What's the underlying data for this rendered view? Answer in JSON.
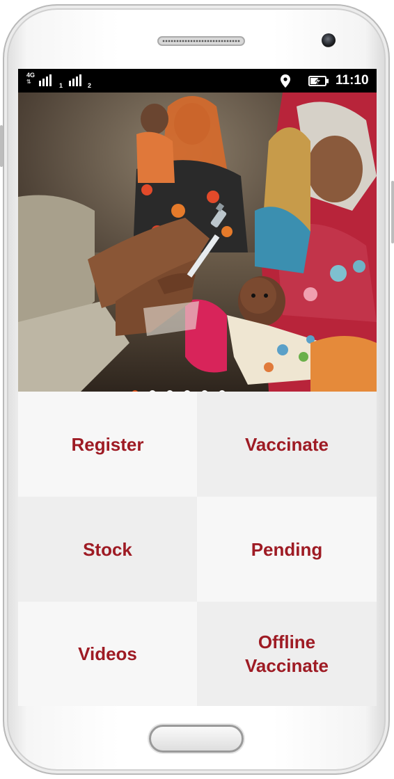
{
  "statusbar": {
    "network_type": "4G",
    "sim1_label": "1",
    "sim2_label": "2",
    "time": "11:10",
    "icons": [
      "signal-icon",
      "location-icon",
      "battery-charging-icon"
    ]
  },
  "carousel": {
    "slide_count": 6,
    "active_index": 0,
    "active_dot_color": "#e54d12"
  },
  "menu": {
    "text_color": "#9e1b24",
    "items": [
      {
        "label": "Register",
        "bg": "#f7f7f7"
      },
      {
        "label": "Vaccinate",
        "bg": "#eeeeee"
      },
      {
        "label": "Stock",
        "bg": "#eeeeee"
      },
      {
        "label": "Pending",
        "bg": "#f7f7f7"
      },
      {
        "label": "Videos",
        "bg": "#f7f7f7"
      },
      {
        "label": "Offline\nVaccinate",
        "bg": "#eeeeee"
      }
    ]
  }
}
